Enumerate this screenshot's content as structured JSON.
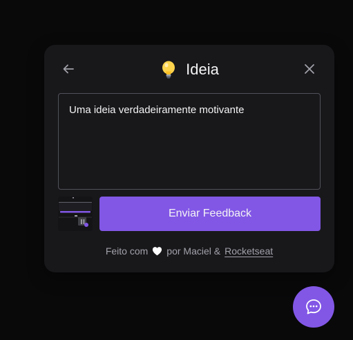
{
  "widget": {
    "title": "Ideia",
    "feedback_type_icon": "lightbulb-icon",
    "back_icon": "arrow-left-icon",
    "close_icon": "close-icon",
    "comment_value": "Uma ideia verdadeiramente motivante",
    "submit_label": "Enviar Feedback",
    "footer": {
      "prefix": "Feito com",
      "heart_icon": "heart-icon",
      "middle": "por Maciel &",
      "link": "Rocketseat"
    }
  },
  "fab": {
    "icon": "chat-bubble-icon"
  },
  "colors": {
    "background": "#09090a",
    "surface": "#18181b",
    "brand": "#8257e6",
    "text": "#f4f4f5",
    "muted": "#a1a1aa",
    "border": "#52525b"
  }
}
